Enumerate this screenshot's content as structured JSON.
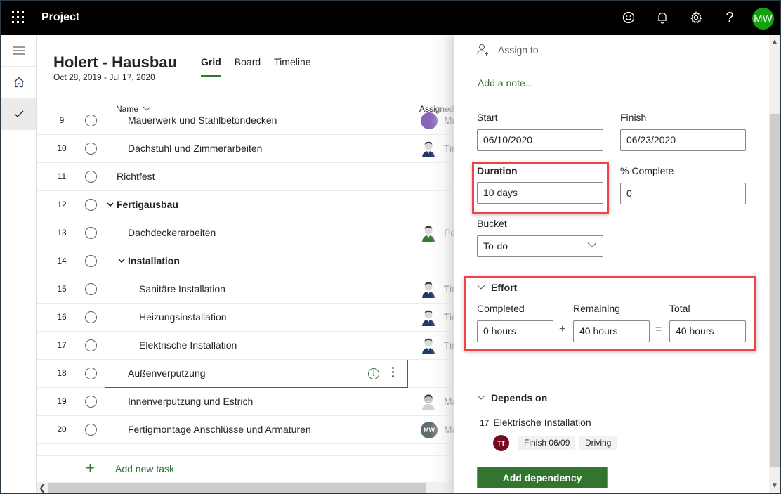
{
  "topbar": {
    "app_name": "Project",
    "icons": [
      "waffle-icon",
      "smiley-icon",
      "bell-icon",
      "gear-icon",
      "help-icon"
    ],
    "help_glyph": "?",
    "user_initials": "MW",
    "user_avatar_color": "#13a10e"
  },
  "rail": {
    "items": [
      "hamburger-icon",
      "home-icon",
      "checkmark-icon"
    ],
    "active": "checkmark-icon"
  },
  "project": {
    "title": "Holert - Hausbau",
    "dates": "Oct 28, 2019 - Jul 17, 2020"
  },
  "tabs": [
    {
      "label": "Grid",
      "active": true
    },
    {
      "label": "Board",
      "active": false
    },
    {
      "label": "Timeline",
      "active": false
    }
  ],
  "columns": {
    "name": "Name",
    "assigned": "Assigned"
  },
  "tasks": [
    {
      "num": "9",
      "name": "Mauerwerk und Stahlbetondecken",
      "indent": 2,
      "bold": false,
      "assignee": "Mi",
      "avatar": "purple"
    },
    {
      "num": "10",
      "name": "Dachstuhl und Zimmerarbeiten",
      "indent": 2,
      "bold": false,
      "assignee": "Tir",
      "avatar": "person-blue"
    },
    {
      "num": "11",
      "name": "Richtfest",
      "indent": 1,
      "bold": false,
      "assignee": "",
      "avatar": ""
    },
    {
      "num": "12",
      "name": "Fertigausbau",
      "indent": 1,
      "bold": true,
      "collapsible": true,
      "assignee": "",
      "avatar": ""
    },
    {
      "num": "13",
      "name": "Dachdeckerarbeiten",
      "indent": 2,
      "bold": false,
      "assignee": "Pe",
      "avatar": "person-green"
    },
    {
      "num": "14",
      "name": "Installation",
      "indent": 2,
      "bold": true,
      "collapsible": true,
      "assignee": "",
      "avatar": ""
    },
    {
      "num": "15",
      "name": "Sanitäre Installation",
      "indent": 3,
      "bold": false,
      "assignee": "Tir",
      "avatar": "person-blue"
    },
    {
      "num": "16",
      "name": "Heizungsinstallation",
      "indent": 3,
      "bold": false,
      "assignee": "Tir",
      "avatar": "person-blue"
    },
    {
      "num": "17",
      "name": "Elektrische Installation",
      "indent": 3,
      "bold": false,
      "assignee": "Tir",
      "avatar": "person-blue"
    },
    {
      "num": "18",
      "name": "Außenverputzung",
      "indent": 2,
      "bold": false,
      "selected": true,
      "assignee": "",
      "avatar": ""
    },
    {
      "num": "19",
      "name": "Innenverputzung und Estrich",
      "indent": 2,
      "bold": false,
      "assignee": "Ma",
      "avatar": "photo"
    },
    {
      "num": "20",
      "name": "Fertigmontage Anschlüsse und Armaturen",
      "indent": 2,
      "bold": false,
      "assignee": "Ma",
      "avatar": "MW"
    }
  ],
  "add_task_label": "Add new task",
  "panel": {
    "assign_label": "Assign to",
    "add_note": "Add a note...",
    "start_label": "Start",
    "start_value": "06/10/2020",
    "finish_label": "Finish",
    "finish_value": "06/23/2020",
    "duration_label": "Duration",
    "duration_value": "10 days",
    "complete_label": "% Complete",
    "complete_value": "0",
    "bucket_label": "Bucket",
    "bucket_value": "To-do",
    "effort": {
      "title": "Effort",
      "completed_label": "Completed",
      "completed_value": "0 hours",
      "plus": "+",
      "remaining_label": "Remaining",
      "remaining_value": "40 hours",
      "equals": "=",
      "total_label": "Total",
      "total_value": "40 hours"
    },
    "depends": {
      "title": "Depends on",
      "task_num": "17",
      "task_name": "Elektrische Installation",
      "assignee_initials": "TT",
      "assignee_color": "#750b1c",
      "chip_finish": "Finish 06/09",
      "chip_type": "Driving"
    },
    "add_dependency": "Add dependency"
  },
  "colors": {
    "accent": "#31752f",
    "highlight": "#ef4349"
  }
}
